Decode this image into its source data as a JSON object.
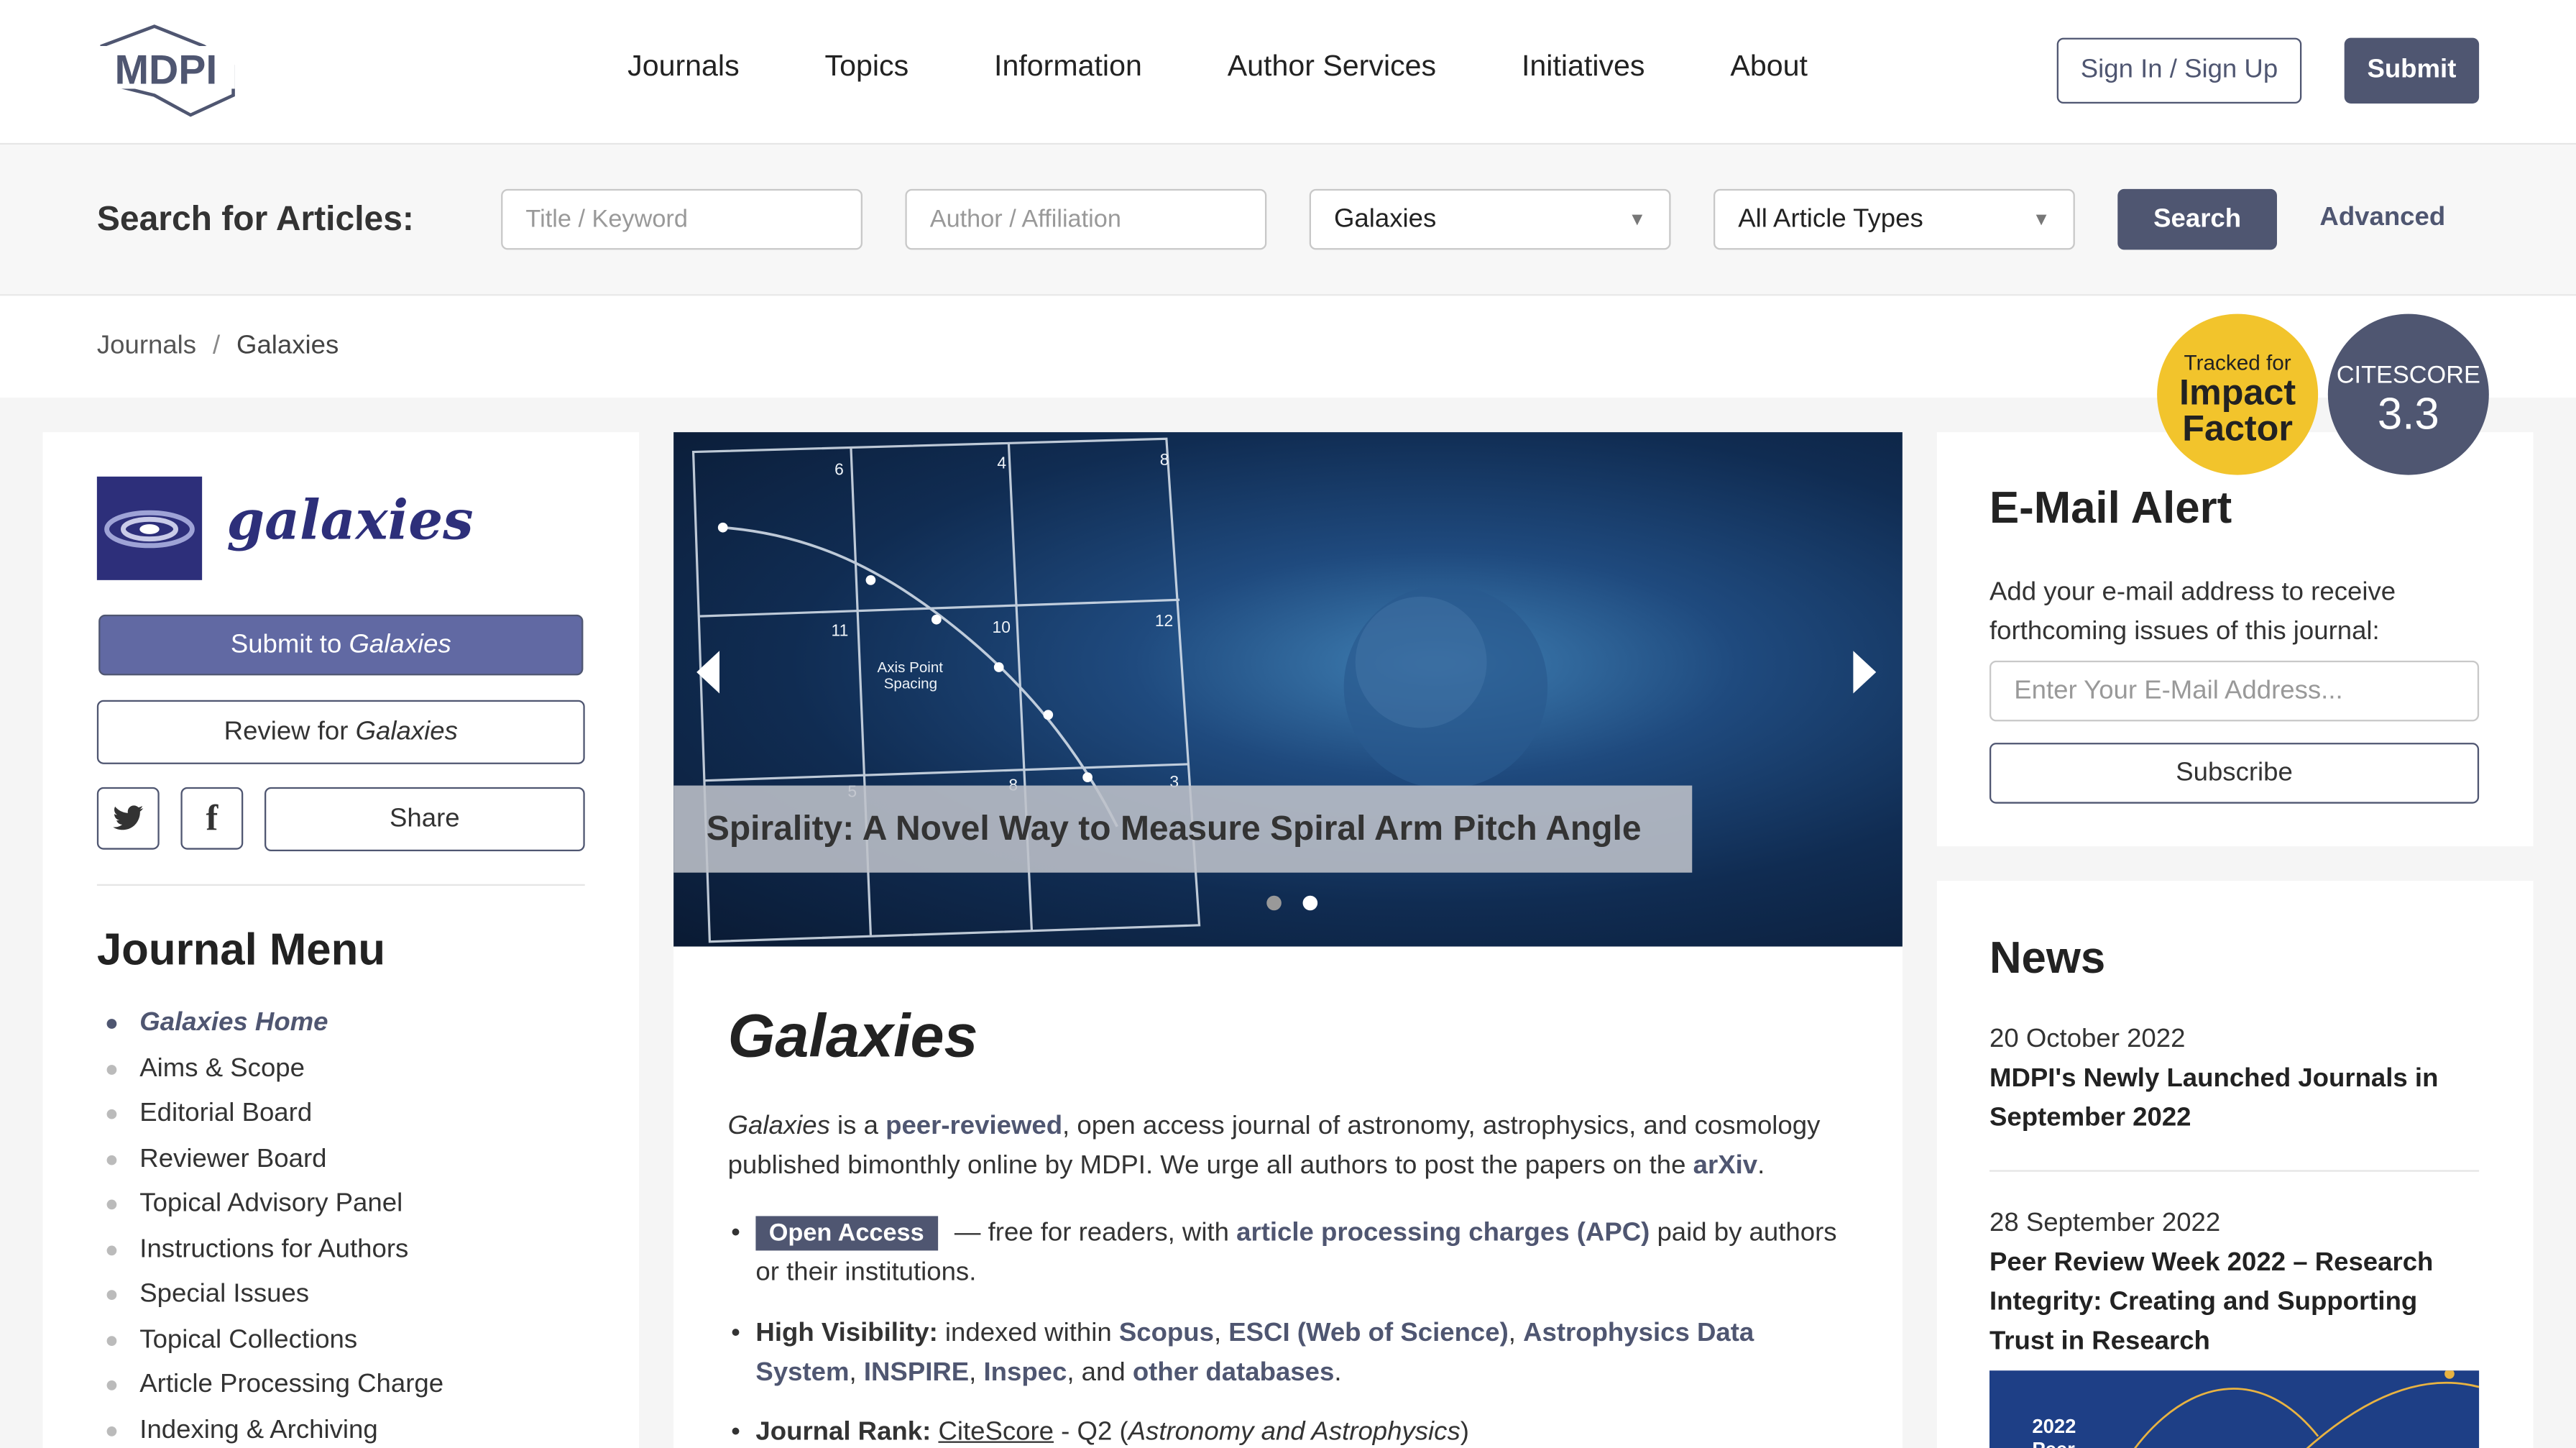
{
  "header": {
    "logo_text": "MDPI",
    "nav": [
      "Journals",
      "Topics",
      "Information",
      "Author Services",
      "Initiatives",
      "About"
    ],
    "signin_label": "Sign In / Sign Up",
    "submit_label": "Submit"
  },
  "search": {
    "label": "Search for Articles:",
    "title_placeholder": "Title / Keyword",
    "author_placeholder": "Author / Affiliation",
    "journal_value": "Galaxies",
    "type_value": "All Article Types",
    "search_label": "Search",
    "advanced_label": "Advanced"
  },
  "breadcrumb": {
    "root": "Journals",
    "sep": "/",
    "current": "Galaxies"
  },
  "badges": {
    "if_small": "Tracked for",
    "if_big1": "Impact",
    "if_big2": "Factor",
    "cs_small": "CITESCORE",
    "cs_value": "3.3"
  },
  "sidebar": {
    "journal_name": "galaxies",
    "submit_prefix": "Submit to ",
    "submit_journal": "Galaxies",
    "review_prefix": "Review for ",
    "review_journal": "Galaxies",
    "twitter_icon": "twitter-icon",
    "facebook_icon": "facebook-icon",
    "share_label": "Share",
    "menu_title": "Journal Menu",
    "menu_items": [
      "Galaxies Home",
      "Aims & Scope",
      "Editorial Board",
      "Reviewer Board",
      "Topical Advisory Panel",
      "Instructions for Authors",
      "Special Issues",
      "Topical Collections",
      "Article Processing Charge",
      "Indexing & Archiving"
    ]
  },
  "hero": {
    "caption": "Spirality: A Novel Way to Measure Spiral Arm Pitch Angle",
    "grid_numbers": [
      "6",
      "4",
      "8",
      "11",
      "10",
      "12",
      "5",
      "8",
      "3"
    ],
    "grid_label_1": "Axis Point",
    "grid_label_2": "Spacing"
  },
  "journal": {
    "title": "Galaxies",
    "intro_journal": "Galaxies",
    "intro_1": " is a ",
    "intro_peer": "peer-reviewed",
    "intro_2": ", open access journal of astronomy, astrophysics, and cosmology published bimonthly online by MDPI. We urge all authors to post the papers on the ",
    "intro_arxiv": "arXiv",
    "intro_3": ".",
    "oa_tag": "Open Access",
    "oa_1": " — free for readers, with ",
    "oa_apc": "article processing charges (APC)",
    "oa_2": " paid by authors or their institutions.",
    "hv_label": "High Visibility:",
    "hv_1": " indexed within ",
    "hv_scopus": "Scopus",
    "hv_c1": ", ",
    "hv_esci": "ESCI (Web of Science)",
    "hv_c2": ", ",
    "hv_ads": "Astrophysics Data System",
    "hv_c3": ", ",
    "hv_inspire": "INSPIRE",
    "hv_c4": ", ",
    "hv_inspec": "Inspec",
    "hv_and": ", and ",
    "hv_other": "other databases",
    "hv_end": ".",
    "jr_label": "Journal Rank:",
    "jr_sp": " ",
    "jr_cite": "CiteScore",
    "jr_1": " - Q2 (",
    "jr_cat": "Astronomy and Astrophysics",
    "jr_2": ")"
  },
  "alert": {
    "title": "E-Mail Alert",
    "desc": "Add your e-mail address to receive forthcoming issues of this journal:",
    "placeholder": "Enter Your E-Mail Address...",
    "subscribe_label": "Subscribe"
  },
  "news": {
    "title": "News",
    "items": [
      {
        "date": "20 October 2022",
        "headline": "MDPI's Newly Launched Journals in September 2022"
      },
      {
        "date": "28 September 2022",
        "headline": "Peer Review Week 2022 – Research Integrity: Creating and Supporting Trust in Research"
      }
    ],
    "image_text_1": "2022",
    "image_text_2": "Peer"
  }
}
